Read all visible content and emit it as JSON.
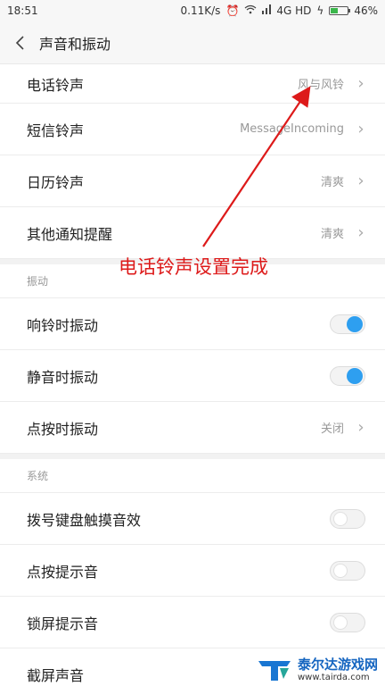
{
  "status_bar": {
    "time": "18:51",
    "network_speed": "0.11K/s",
    "network_type": "4G HD",
    "battery": "46%",
    "battery_level": 0.46,
    "icons": [
      "alarm-icon",
      "wifi-icon",
      "signal-icon",
      "charging-icon",
      "battery-icon"
    ]
  },
  "header": {
    "title": "声音和振动",
    "back_icon": "chevron-left-icon"
  },
  "ringtones": [
    {
      "label": "电话铃声",
      "value": "风与风铃"
    },
    {
      "label": "短信铃声",
      "value": "MessageIncoming"
    },
    {
      "label": "日历铃声",
      "value": "清爽"
    },
    {
      "label": "其他通知提醒",
      "value": "清爽"
    }
  ],
  "vibration": {
    "section_title": "振动",
    "items": [
      {
        "label": "响铃时振动",
        "on": true
      },
      {
        "label": "静音时振动",
        "on": true
      },
      {
        "label": "点按时振动",
        "value": "关闭"
      }
    ]
  },
  "system": {
    "section_title": "系统",
    "items": [
      {
        "label": "拨号键盘触摸音效",
        "on": false
      },
      {
        "label": "点按提示音",
        "on": false
      },
      {
        "label": "锁屏提示音",
        "on": false
      },
      {
        "label": "截屏声音"
      }
    ]
  },
  "annotation": {
    "text": "电话铃声设置完成",
    "color": "#dd1a1a"
  },
  "watermark": {
    "title": "泰尔达游戏网",
    "url": "www.tairda.com"
  },
  "colors": {
    "toggle_on": "#2e9ff0",
    "annotation": "#dd1a1a"
  }
}
